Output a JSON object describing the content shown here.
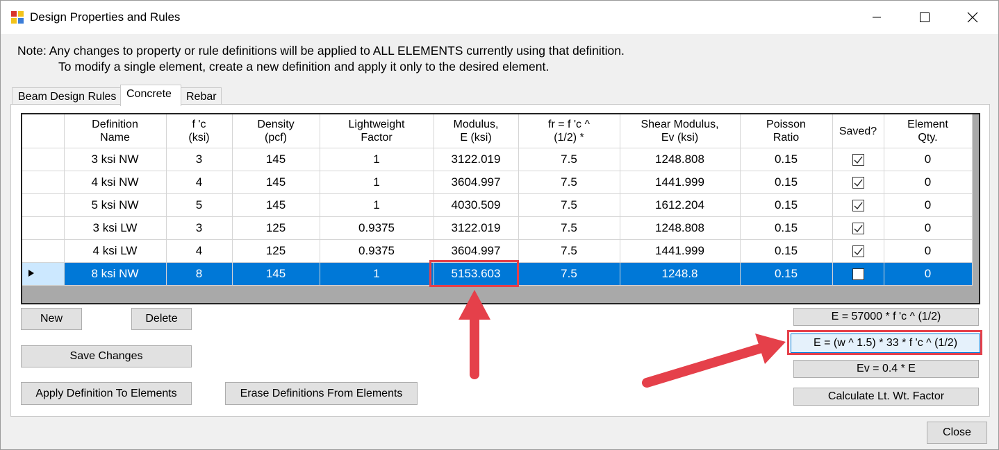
{
  "window": {
    "title": "Design Properties and Rules",
    "minimize_icon": "minimize-icon",
    "maximize_icon": "maximize-icon",
    "close_icon": "close-icon"
  },
  "note": {
    "line1": "Note:   Any changes to property or rule definitions will be applied to ALL ELEMENTS currently using that definition.",
    "line2": "To modify a single element, create a new definition and apply it only to the desired element."
  },
  "tabs": [
    {
      "label": "Beam Design Rules",
      "active": false
    },
    {
      "label": "Concrete",
      "active": true
    },
    {
      "label": "Rebar",
      "active": false
    }
  ],
  "grid": {
    "columns": [
      {
        "line1": "Definition",
        "line2": "Name"
      },
      {
        "line1": "f 'c",
        "line2": "(ksi)"
      },
      {
        "line1": "Density",
        "line2": "(pcf)"
      },
      {
        "line1": "Lightweight",
        "line2": "Factor"
      },
      {
        "line1": "Modulus,",
        "line2": "E (ksi)"
      },
      {
        "line1": "fr = f 'c ^",
        "line2": "(1/2) *"
      },
      {
        "line1": "Shear Modulus,",
        "line2": "Ev (ksi)"
      },
      {
        "line1": "Poisson",
        "line2": "Ratio"
      },
      {
        "line1": "Saved?",
        "line2": ""
      },
      {
        "line1": "Element",
        "line2": "Qty."
      }
    ],
    "rows": [
      {
        "name": "3 ksi NW",
        "fc": "3",
        "density": "145",
        "lw": "1",
        "e": "3122.019",
        "fr": "7.5",
        "ev": "1248.808",
        "poisson": "0.15",
        "saved": true,
        "qty": "0"
      },
      {
        "name": "4 ksi NW",
        "fc": "4",
        "density": "145",
        "lw": "1",
        "e": "3604.997",
        "fr": "7.5",
        "ev": "1441.999",
        "poisson": "0.15",
        "saved": true,
        "qty": "0"
      },
      {
        "name": "5 ksi NW",
        "fc": "5",
        "density": "145",
        "lw": "1",
        "e": "4030.509",
        "fr": "7.5",
        "ev": "1612.204",
        "poisson": "0.15",
        "saved": true,
        "qty": "0"
      },
      {
        "name": "3 ksi LW",
        "fc": "3",
        "density": "125",
        "lw": "0.9375",
        "e": "3122.019",
        "fr": "7.5",
        "ev": "1248.808",
        "poisson": "0.15",
        "saved": true,
        "qty": "0"
      },
      {
        "name": "4 ksi LW",
        "fc": "4",
        "density": "125",
        "lw": "0.9375",
        "e": "3604.997",
        "fr": "7.5",
        "ev": "1441.999",
        "poisson": "0.15",
        "saved": true,
        "qty": "0"
      },
      {
        "name": "8 ksi NW",
        "fc": "8",
        "density": "145",
        "lw": "1",
        "e": "5153.603",
        "fr": "7.5",
        "ev": "1248.8",
        "poisson": "0.15",
        "saved": false,
        "qty": "0"
      }
    ],
    "selected_row": 5,
    "selected_color": "#0078d7"
  },
  "buttons": {
    "new": "New",
    "delete": "Delete",
    "save_changes": "Save Changes",
    "apply": "Apply Definition To Elements",
    "erase": "Erase Definitions From Elements",
    "e_formula1": "E = 57000 * f 'c ^ (1/2)",
    "e_formula2": "E = (w ^ 1.5) * 33 * f 'c ^ (1/2)",
    "ev_formula": "Ev = 0.4 * E",
    "calc_lw": "Calculate Lt. Wt. Factor",
    "close": "Close"
  },
  "annotation_color": "#e5404a"
}
